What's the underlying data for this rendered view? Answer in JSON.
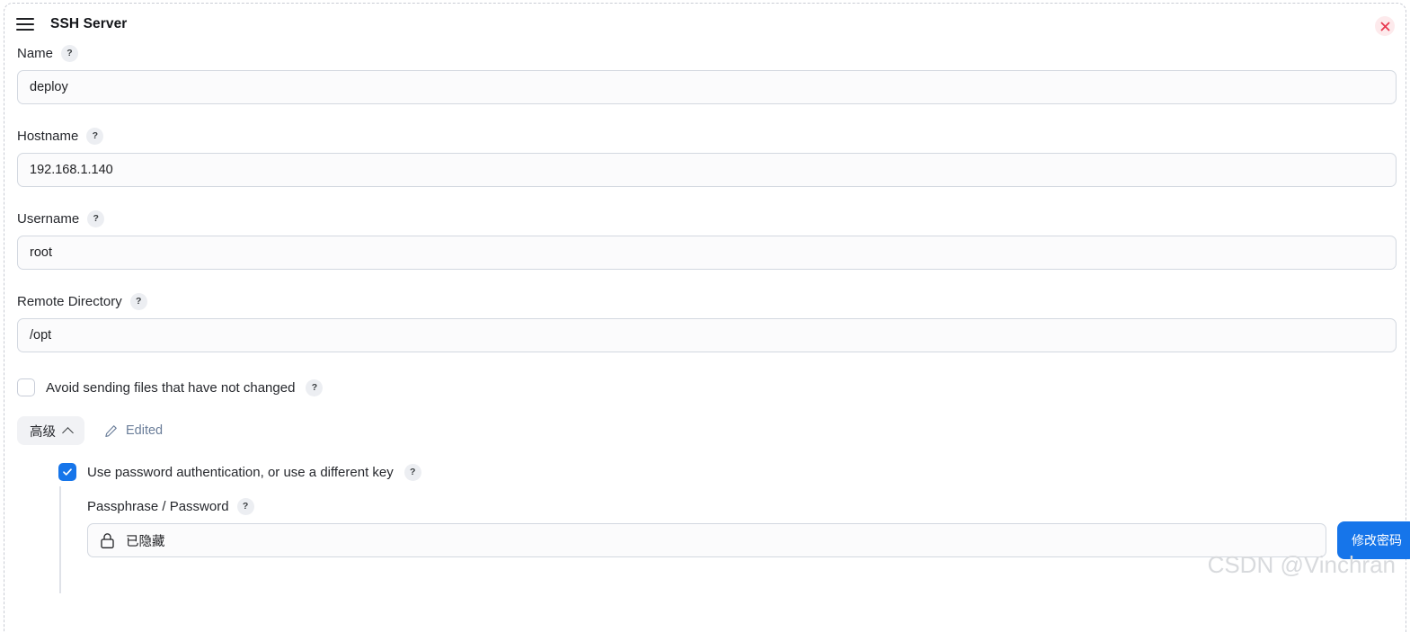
{
  "window": {
    "title": "SSH Server",
    "menu_icon": "hamburger-icon",
    "close_icon": "close-icon"
  },
  "fields": [
    {
      "label": "Name",
      "value": "deploy",
      "help": "?"
    },
    {
      "label": "Hostname",
      "value": "192.168.1.140",
      "help": "?"
    },
    {
      "label": "Username",
      "value": "root",
      "help": "?"
    },
    {
      "label": "Remote Directory",
      "value": "/opt",
      "help": "?"
    }
  ],
  "avoid_option": {
    "label": "Avoid sending files that have not changed",
    "checked": false,
    "help": "?"
  },
  "advanced": {
    "button_label": "高级",
    "expanded": true,
    "chevron_icon": "chevron-up-icon",
    "edited_label": "Edited",
    "edit_icon": "pencil-icon",
    "password_auth": {
      "label": "Use password authentication, or use a different key",
      "checked": true,
      "help": "?"
    },
    "passphrase": {
      "label": "Passphrase / Password",
      "help": "?",
      "value": "已隐藏",
      "icon": "lock-icon",
      "change_button_label": "修改密码"
    }
  },
  "watermark": "CSDN @Vinchran",
  "colors": {
    "accent": "#1675ea",
    "close_bg": "#fdeaec",
    "close_fg": "#e8384f",
    "border": "#d3d8e0",
    "field_bg": "#fbfbfc",
    "link": "#6a7d99"
  }
}
